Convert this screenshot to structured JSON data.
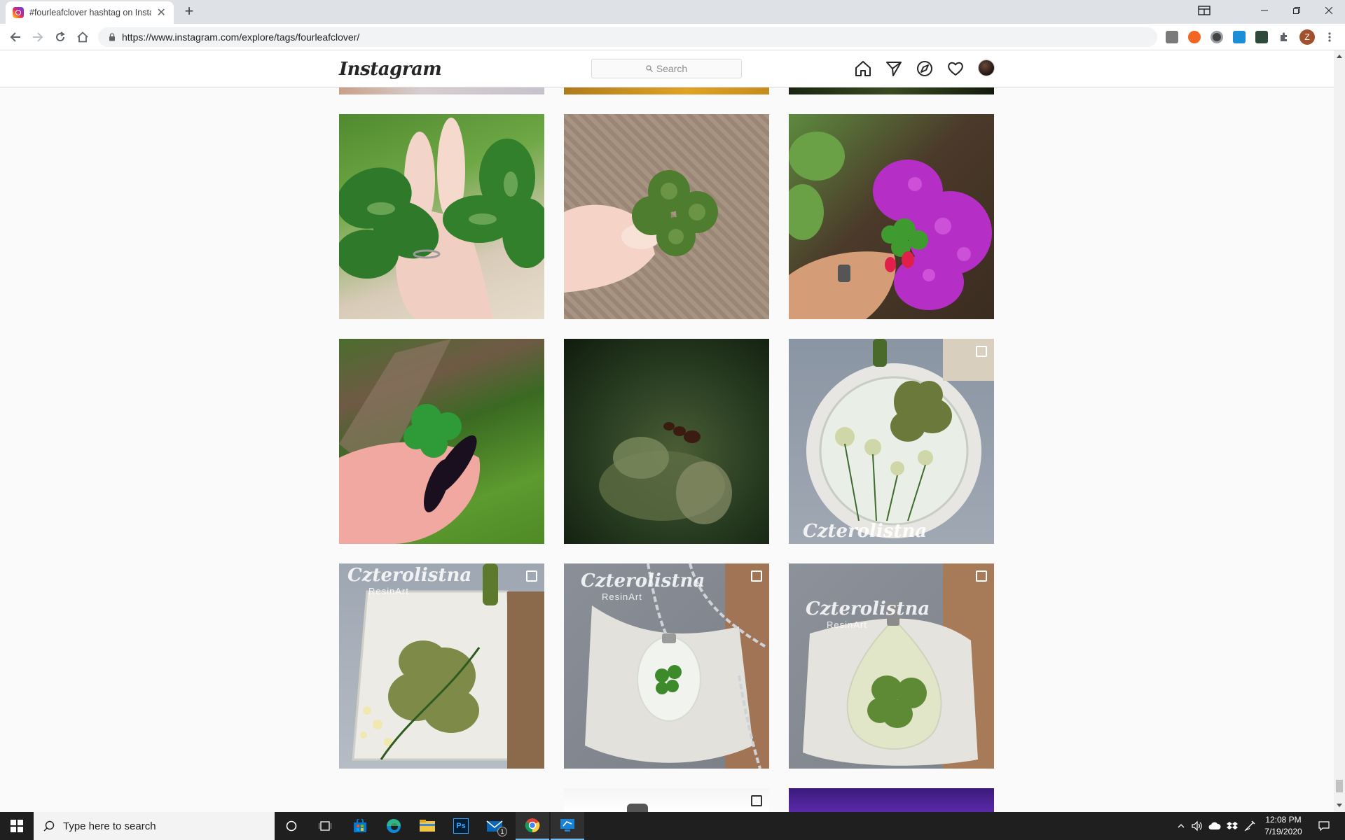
{
  "browser": {
    "tab_title": "#fourleafclover hashtag on Insta",
    "tab_close": "✕",
    "new_tab": "+",
    "url": "https://www.instagram.com/explore/tags/fourleafclover/",
    "profile_initial": "Z"
  },
  "instagram": {
    "logo": "Instagram",
    "search_placeholder": "Search"
  },
  "grid": {
    "tiles": [
      {
        "row": 1,
        "col": 1,
        "subject": "hand holding two large clovers",
        "multi": false
      },
      {
        "row": 1,
        "col": 2,
        "subject": "four-leaf clover on woven mat",
        "multi": false
      },
      {
        "row": 1,
        "col": 3,
        "subject": "clover held near pink flowers",
        "multi": false
      },
      {
        "row": 2,
        "col": 1,
        "subject": "clover held with dark nails",
        "multi": false
      },
      {
        "row": 2,
        "col": 2,
        "subject": "ant on clover macro",
        "multi": false
      },
      {
        "row": 2,
        "col": 3,
        "subject": "resin pendant with clover",
        "multi": true,
        "watermark": "Czterolistna"
      },
      {
        "row": 3,
        "col": 1,
        "subject": "resin clover art",
        "multi": true,
        "watermark": "Czterolistna",
        "watermark_sub": "ResinArt"
      },
      {
        "row": 3,
        "col": 2,
        "subject": "clover necklace",
        "multi": true,
        "watermark": "Czterolistna",
        "watermark_sub": "ResinArt"
      },
      {
        "row": 3,
        "col": 3,
        "subject": "clover drop pendant",
        "multi": true,
        "watermark": "Czterolistna",
        "watermark_sub": "ResinArt"
      }
    ]
  },
  "taskbar": {
    "search_text": "Type here to search",
    "mail_badge": "1",
    "time": "12:08 PM",
    "date": "7/19/2020"
  }
}
